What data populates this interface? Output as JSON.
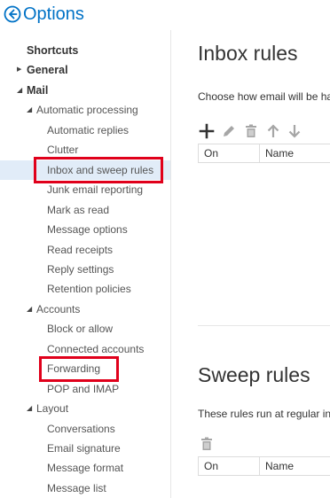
{
  "header": {
    "title": "Options",
    "back_icon": "back-arrow-circle-icon",
    "accent_color": "#0072c6"
  },
  "sidebar": {
    "items": [
      {
        "label": "Shortcuts",
        "level": 0,
        "expander": ""
      },
      {
        "label": "General",
        "level": 0,
        "expander": "collapsed"
      },
      {
        "label": "Mail",
        "level": 0,
        "expander": "expanded"
      },
      {
        "label": "Automatic processing",
        "level": 1,
        "expander": "expanded"
      },
      {
        "label": "Automatic replies",
        "level": 2
      },
      {
        "label": "Clutter",
        "level": 2
      },
      {
        "label": "Inbox and sweep rules",
        "level": 2,
        "selected": true,
        "highlighted": true
      },
      {
        "label": "Junk email reporting",
        "level": 2
      },
      {
        "label": "Mark as read",
        "level": 2
      },
      {
        "label": "Message options",
        "level": 2
      },
      {
        "label": "Read receipts",
        "level": 2
      },
      {
        "label": "Reply settings",
        "level": 2
      },
      {
        "label": "Retention policies",
        "level": 2
      },
      {
        "label": "Accounts",
        "level": 1,
        "expander": "expanded"
      },
      {
        "label": "Block or allow",
        "level": 2
      },
      {
        "label": "Connected accounts",
        "level": 2
      },
      {
        "label": "Forwarding",
        "level": 2,
        "highlighted": true
      },
      {
        "label": "POP and IMAP",
        "level": 2
      },
      {
        "label": "Layout",
        "level": 1,
        "expander": "expanded"
      },
      {
        "label": "Conversations",
        "level": 2
      },
      {
        "label": "Email signature",
        "level": 2
      },
      {
        "label": "Message format",
        "level": 2
      },
      {
        "label": "Message list",
        "level": 2
      }
    ],
    "selected_bg": "#e1ecf8",
    "highlight_color": "#e0001b"
  },
  "inbox_rules": {
    "title": "Inbox rules",
    "description": "Choose how email will be ha",
    "toolbar_icons": [
      "add-icon",
      "edit-pencil-icon",
      "delete-trash-icon",
      "move-up-arrow-icon",
      "move-down-arrow-icon"
    ],
    "columns": [
      "On",
      "Name"
    ]
  },
  "sweep_rules": {
    "title": "Sweep rules",
    "description": "These rules run at regular int",
    "toolbar_icons": [
      "delete-trash-icon"
    ],
    "columns": [
      "On",
      "Name"
    ]
  }
}
